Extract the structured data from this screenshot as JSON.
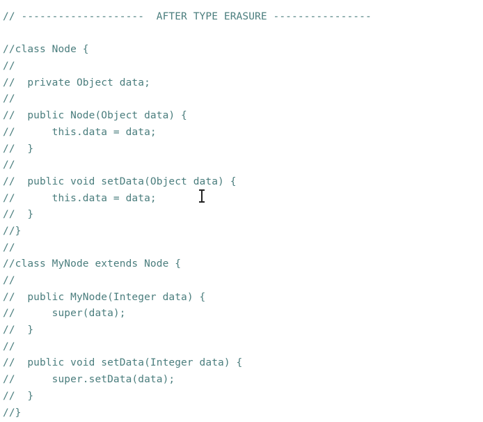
{
  "editor": {
    "lines": [
      "// --------------------  AFTER TYPE ERASURE ----------------",
      "",
      "//class Node {",
      "//",
      "//  private Object data;",
      "//",
      "//  public Node(Object data) {",
      "//      this.data = data;",
      "//  }",
      "//",
      "//  public void setData(Object data) {",
      "//      this.data = data;",
      "//  }",
      "//}",
      "//",
      "//class MyNode extends Node {",
      "//",
      "//  public MyNode(Integer data) {",
      "//      super(data);",
      "//  }",
      "//",
      "//  public void setData(Integer data) {",
      "//      super.setData(data);",
      "//  }",
      "//}"
    ],
    "text_color": "#4a7d7d",
    "cursor_icon": "text-cursor-icon"
  }
}
